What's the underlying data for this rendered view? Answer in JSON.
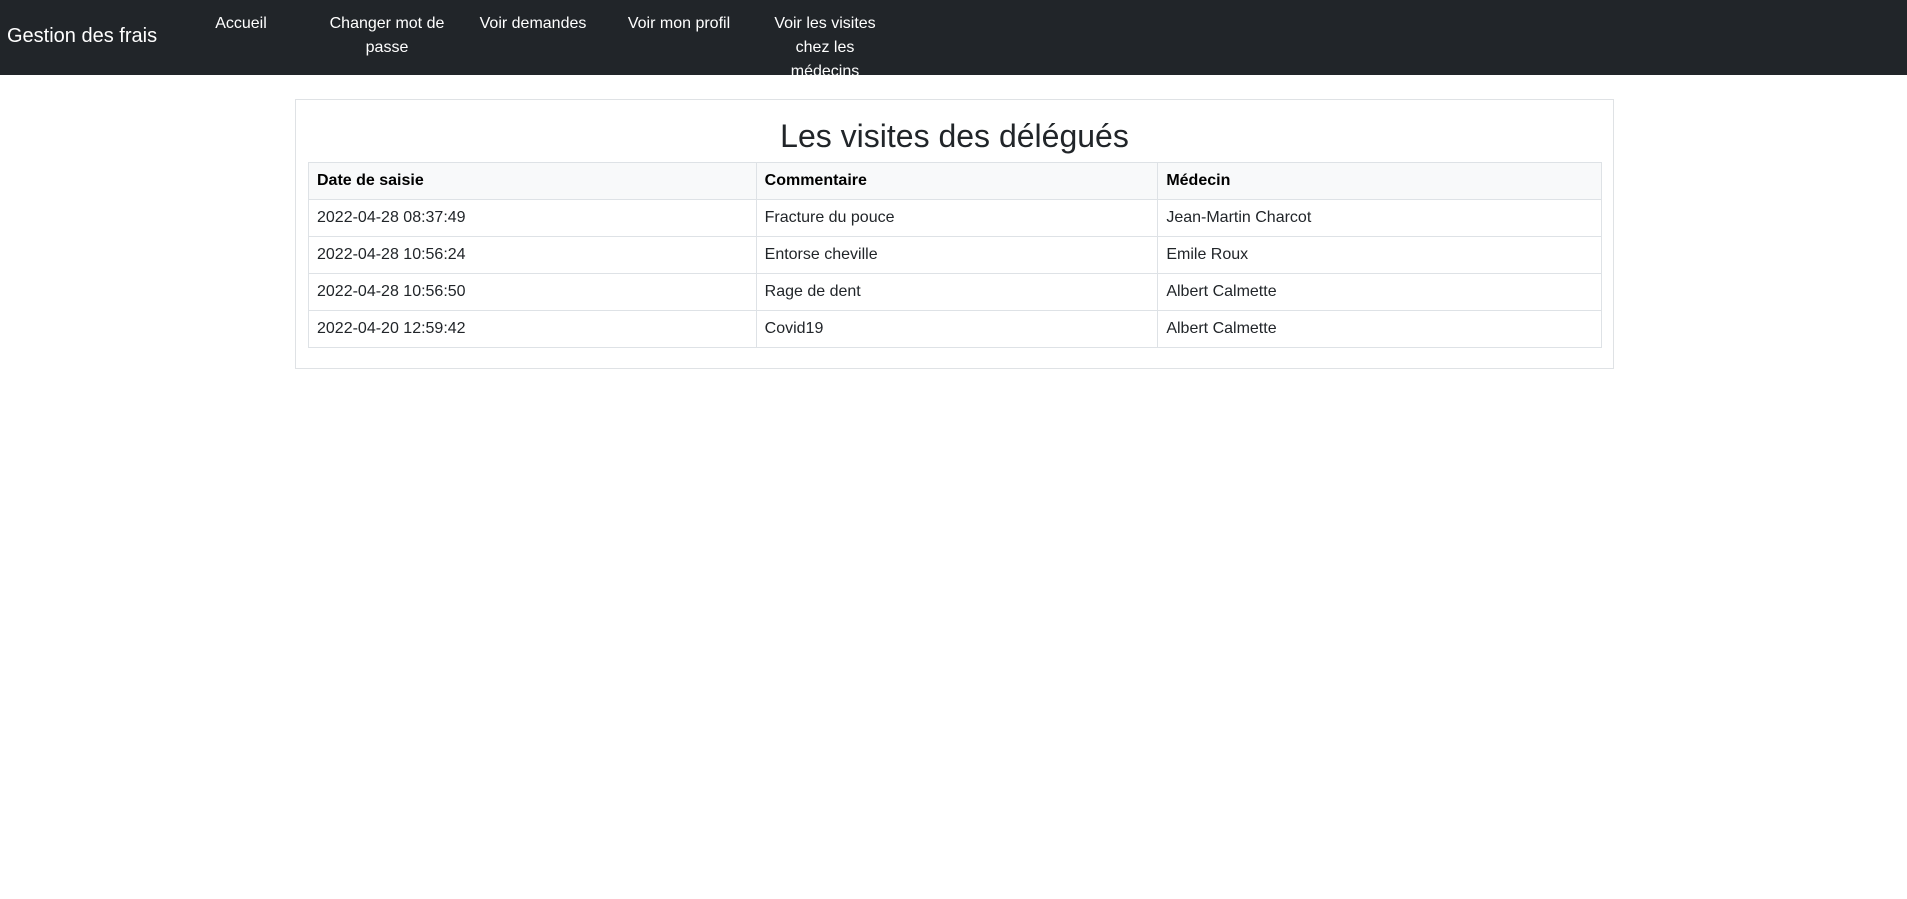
{
  "navbar": {
    "brand": "Gestion des frais",
    "items": [
      {
        "label": "Accueil"
      },
      {
        "label": "Changer mot de passe"
      },
      {
        "label": "Voir demandes"
      },
      {
        "label": "Voir mon profil"
      },
      {
        "label": "Voir les visites chez les médecins"
      }
    ],
    "background": "#212529"
  },
  "main": {
    "title": "Les visites des délégués",
    "table": {
      "headers": [
        "Date de saisie",
        "Commentaire",
        "Médecin"
      ],
      "rows": [
        [
          "2022-04-28 08:37:49",
          "Fracture du pouce",
          "Jean-Martin Charcot"
        ],
        [
          "2022-04-28 10:56:24",
          "Entorse cheville",
          "Emile Roux"
        ],
        [
          "2022-04-28 10:56:50",
          "Rage de dent",
          "Albert Calmette"
        ],
        [
          "2022-04-20 12:59:42",
          "Covid19",
          "Albert Calmette"
        ]
      ]
    }
  }
}
